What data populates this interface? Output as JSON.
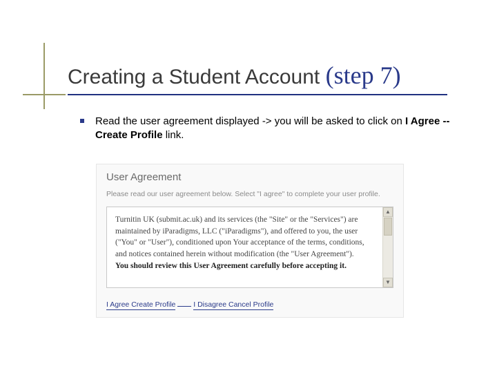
{
  "title": {
    "main": "Creating a Student Account",
    "step": "(step 7)"
  },
  "bullet": {
    "text_before": "Read the user agreement displayed -> you will be asked to click on ",
    "bold_part": "I Agree -- Create Profile",
    "text_after": " link."
  },
  "embed": {
    "heading": "User Agreement",
    "subheading": "Please read our user agreement below. Select \"I agree\" to complete your user profile.",
    "agreement_text": "Turnitin UK (submit.ac.uk) and its services (the \"Site\" or the \"Services\") are maintained by iParadigms, LLC (\"iParadigms\"), and offered to you, the user (\"You\" or \"User\"), conditioned upon Your acceptance of the terms, conditions, and notices contained herein without modification (the \"User Agreement\").",
    "agreement_last": "You should review this User Agreement carefully before accepting it.",
    "link_agree": "I Agree   Create Profile",
    "link_disagree": "I Disagree   Cancel Profile"
  }
}
